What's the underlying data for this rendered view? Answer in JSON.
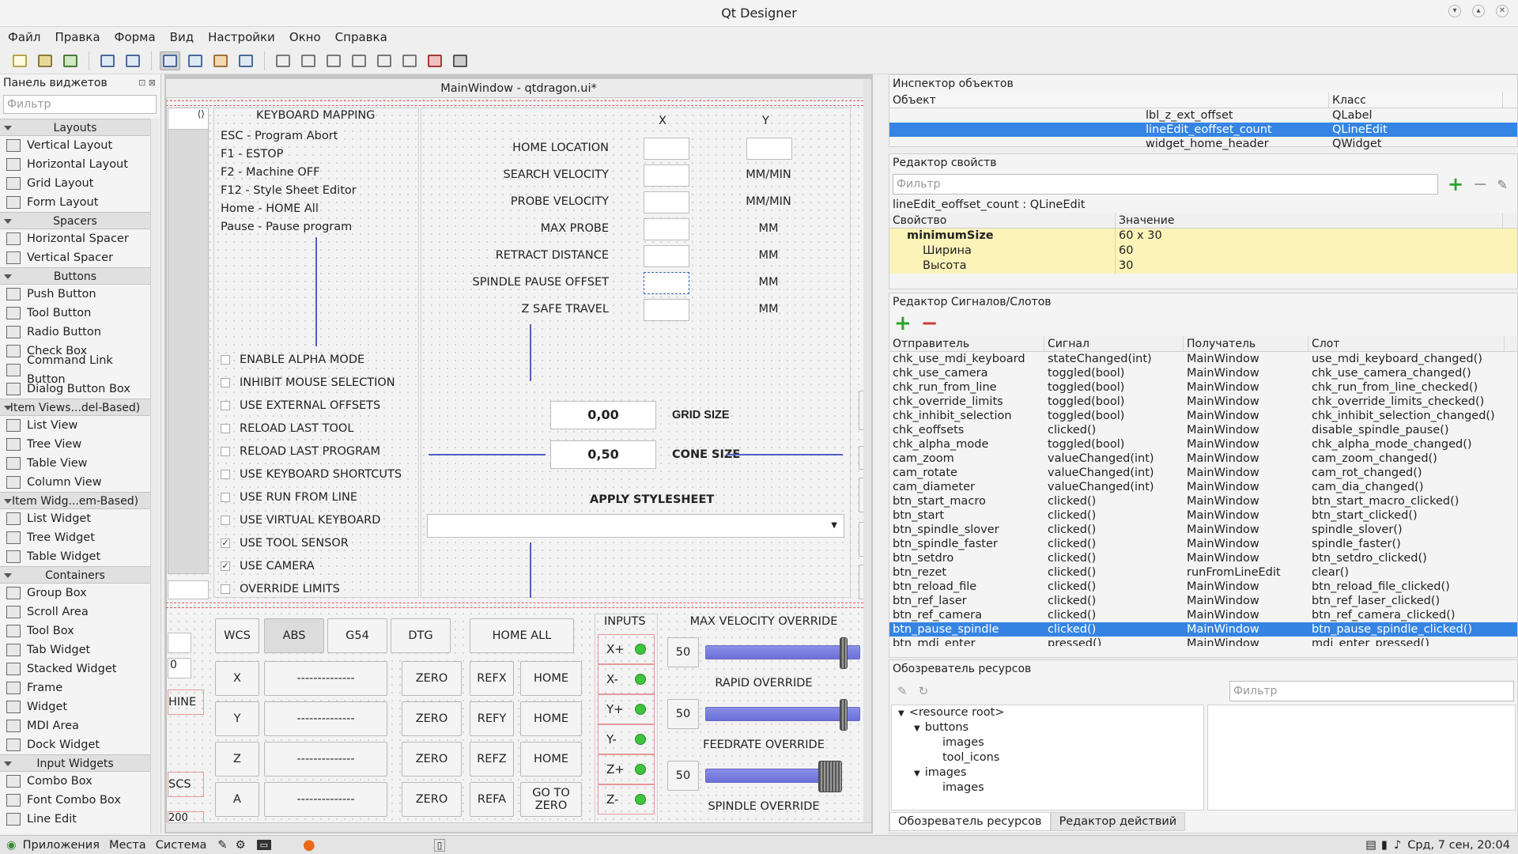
{
  "window": {
    "title": "Qt Designer"
  },
  "menu": [
    "Файл",
    "Правка",
    "Форма",
    "Вид",
    "Настройки",
    "Окно",
    "Справка"
  ],
  "toolbar_icons": [
    "new-icon",
    "open-icon",
    "save-icon",
    "send-to-back-icon",
    "bring-to-front-icon",
    "edit-widgets-icon",
    "edit-signals-icon",
    "edit-buddies-icon",
    "edit-tab-order-icon",
    "layout-horizontal-icon",
    "layout-vertical-icon",
    "layout-horizontal-splitter-icon",
    "layout-vertical-splitter-icon",
    "layout-grid-icon",
    "layout-form-icon",
    "break-layout-icon",
    "adjust-size-icon"
  ],
  "widget_box": {
    "title": "Панель виджетов",
    "filter_placeholder": "Фильтр",
    "categories": [
      {
        "name": "Layouts",
        "items": [
          "Vertical Layout",
          "Horizontal Layout",
          "Grid Layout",
          "Form Layout"
        ]
      },
      {
        "name": "Spacers",
        "items": [
          "Horizontal Spacer",
          "Vertical Spacer"
        ]
      },
      {
        "name": "Buttons",
        "items": [
          "Push Button",
          "Tool Button",
          "Radio Button",
          "Check Box",
          "Command Link Button",
          "Dialog Button Box"
        ]
      },
      {
        "name": "Item Views...del-Based)",
        "items": [
          "List View",
          "Tree View",
          "Table View",
          "Column View"
        ]
      },
      {
        "name": "Item Widg...em-Based)",
        "items": [
          "List Widget",
          "Tree Widget",
          "Table Widget"
        ]
      },
      {
        "name": "Containers",
        "items": [
          "Group Box",
          "Scroll Area",
          "Tool Box",
          "Tab Widget",
          "Stacked Widget",
          "Frame",
          "Widget",
          "MDI Area",
          "Dock Widget"
        ]
      },
      {
        "name": "Input Widgets",
        "items": [
          "Combo Box",
          "Font Combo Box",
          "Line Edit"
        ]
      }
    ]
  },
  "form": {
    "title": "MainWindow - qtdragon.ui*",
    "keyboard": {
      "heading": "KEYBOARD MAPPING",
      "lines": [
        "ESC - Program Abort",
        "F1 - ESTOP",
        "F2 - Machine OFF",
        "F12 - Style Sheet Editor",
        "Home - HOME All",
        "Pause - Pause program"
      ]
    },
    "checkboxes": [
      {
        "label": "ENABLE ALPHA MODE",
        "checked": false
      },
      {
        "label": "INHIBIT MOUSE SELECTION",
        "checked": false
      },
      {
        "label": "USE EXTERNAL OFFSETS",
        "checked": false
      },
      {
        "label": "RELOAD LAST TOOL",
        "checked": false
      },
      {
        "label": "RELOAD LAST PROGRAM",
        "checked": false
      },
      {
        "label": "USE KEYBOARD SHORTCUTS",
        "checked": false
      },
      {
        "label": "USE RUN FROM LINE",
        "checked": false
      },
      {
        "label": "USE VIRTUAL KEYBOARD",
        "checked": false
      },
      {
        "label": "USE TOOL SENSOR",
        "checked": true
      },
      {
        "label": "USE CAMERA",
        "checked": true
      },
      {
        "label": "OVERRIDE LIMITS",
        "checked": false
      }
    ],
    "col_x": "X",
    "col_y": "Y",
    "params": [
      {
        "label": "HOME LOCATION",
        "unit": ""
      },
      {
        "label": "SEARCH VELOCITY",
        "unit": "MM/MIN"
      },
      {
        "label": "PROBE VELOCITY",
        "unit": "MM/MIN"
      },
      {
        "label": "MAX PROBE",
        "unit": "MM"
      },
      {
        "label": "RETRACT DISTANCE",
        "unit": "MM"
      },
      {
        "label": "SPINDLE PAUSE OFFSET",
        "unit": "MM"
      },
      {
        "label": "Z SAFE TRAVEL",
        "unit": "MM"
      }
    ],
    "grid_size": {
      "value": "0,00",
      "label": "GRID SIZE"
    },
    "cone_size": {
      "value": "0,50",
      "label": "CONE SIZE"
    },
    "apply_stylesheet": "APPLY STYLESHEET",
    "left_fragments": [
      "HINE",
      "SCS",
      "0",
      "200"
    ],
    "dro_header": [
      "WCS",
      "ABS",
      "G54",
      "DTG",
      "HOME ALL"
    ],
    "dro_rows": [
      {
        "axis": "X",
        "value": "--------------",
        "zero": "ZERO",
        "ref": "REFX",
        "home": "HOME"
      },
      {
        "axis": "Y",
        "value": "--------------",
        "zero": "ZERO",
        "ref": "REFY",
        "home": "HOME"
      },
      {
        "axis": "Z",
        "value": "--------------",
        "zero": "ZERO",
        "ref": "REFZ",
        "home": "HOME"
      },
      {
        "axis": "A",
        "value": "--------------",
        "zero": "ZERO",
        "ref": "REFA",
        "home": "GO TO ZERO"
      }
    ],
    "inputs": {
      "title": "INPUTS",
      "items": [
        "X+",
        "X-",
        "Y+",
        "Y-",
        "Z+",
        "Z-"
      ]
    },
    "overrides": [
      {
        "label": "MAX VELOCITY OVERRIDE",
        "value": "50",
        "level": 1.0
      },
      {
        "label": "RAPID OVERRIDE",
        "value": "50",
        "level": 1.0
      },
      {
        "label": "FEEDRATE OVERRIDE",
        "value": "50",
        "level": 0.86
      },
      {
        "label": "SPINDLE OVERRIDE",
        "value": "",
        "level": 0
      }
    ]
  },
  "object_inspector": {
    "title": "Инспектор объектов",
    "col_object": "Объект",
    "col_class": "Класс",
    "rows": [
      {
        "object": "lbl_z_ext_offset",
        "class": "QLabel",
        "selected": false
      },
      {
        "object": "lineEdit_eoffset_count",
        "class": "QLineEdit",
        "selected": true
      },
      {
        "object": "widget_home_header",
        "class": "QWidget",
        "selected": false
      }
    ]
  },
  "property_editor": {
    "title": "Редактор свойств",
    "filter_placeholder": "Фильтр",
    "object_label": "lineEdit_eoffset_count : QLineEdit",
    "col_property": "Свойство",
    "col_value": "Значение",
    "rows": [
      {
        "name": "minimumSize",
        "value": "60 x 30"
      },
      {
        "name": "Ширина",
        "value": "60"
      },
      {
        "name": "Высота",
        "value": "30"
      }
    ]
  },
  "signal_editor": {
    "title": "Редактор Сигналов/Слотов",
    "cols": [
      "Отправитель",
      "Сигнал",
      "Получатель",
      "Слот"
    ],
    "rows": [
      [
        "chk_use_mdi_keyboard",
        "stateChanged(int)",
        "MainWindow",
        "use_mdi_keyboard_changed()"
      ],
      [
        "chk_use_camera",
        "toggled(bool)",
        "MainWindow",
        "chk_use_camera_changed()"
      ],
      [
        "chk_run_from_line",
        "toggled(bool)",
        "MainWindow",
        "chk_run_from_line_checked()"
      ],
      [
        "chk_override_limits",
        "toggled(bool)",
        "MainWindow",
        "chk_override_limits_checked()"
      ],
      [
        "chk_inhibit_selection",
        "toggled(bool)",
        "MainWindow",
        "chk_inhibit_selection_changed()"
      ],
      [
        "chk_eoffsets",
        "clicked()",
        "MainWindow",
        "disable_spindle_pause()"
      ],
      [
        "chk_alpha_mode",
        "toggled(bool)",
        "MainWindow",
        "chk_alpha_mode_changed()"
      ],
      [
        "cam_zoom",
        "valueChanged(int)",
        "MainWindow",
        "cam_zoom_changed()"
      ],
      [
        "cam_rotate",
        "valueChanged(int)",
        "MainWindow",
        "cam_rot_changed()"
      ],
      [
        "cam_diameter",
        "valueChanged(int)",
        "MainWindow",
        "cam_dia_changed()"
      ],
      [
        "btn_start_macro",
        "clicked()",
        "MainWindow",
        "btn_start_macro_clicked()"
      ],
      [
        "btn_start",
        "clicked()",
        "MainWindow",
        "btn_start_clicked()"
      ],
      [
        "btn_spindle_slover",
        "clicked()",
        "MainWindow",
        "spindle_slover()"
      ],
      [
        "btn_spindle_faster",
        "clicked()",
        "MainWindow",
        "spindle_faster()"
      ],
      [
        "btn_setdro",
        "clicked()",
        "MainWindow",
        "btn_setdro_clicked()"
      ],
      [
        "btn_rezet",
        "clicked()",
        "runFromLineEdit",
        "clear()"
      ],
      [
        "btn_reload_file",
        "clicked()",
        "MainWindow",
        "btn_reload_file_clicked()"
      ],
      [
        "btn_ref_laser",
        "clicked()",
        "MainWindow",
        "btn_ref_laser_clicked()"
      ],
      [
        "btn_ref_camera",
        "clicked()",
        "MainWindow",
        "btn_ref_camera_clicked()"
      ],
      [
        "btn_pause_spindle",
        "clicked()",
        "MainWindow",
        "btn_pause_spindle_clicked()"
      ],
      [
        "btn_mdi_enter",
        "pressed()",
        "MainWindow",
        "mdi_enter_pressed()"
      ]
    ],
    "selected_index": 19
  },
  "resource_browser": {
    "title": "Обозреватель ресурсов",
    "filter_placeholder": "Фильтр",
    "tree": [
      {
        "label": "<resource root>",
        "depth": 0
      },
      {
        "label": "buttons",
        "depth": 1
      },
      {
        "label": "images",
        "depth": 2
      },
      {
        "label": "tool_icons",
        "depth": 2
      },
      {
        "label": "images",
        "depth": 1
      },
      {
        "label": "images",
        "depth": 2
      }
    ],
    "tabs": [
      "Обозреватель ресурсов",
      "Редактор действий"
    ]
  },
  "taskbar": {
    "items": [
      "Приложения",
      "Места",
      "Система"
    ],
    "clock": "Срд, 7 сен, 20:04"
  }
}
